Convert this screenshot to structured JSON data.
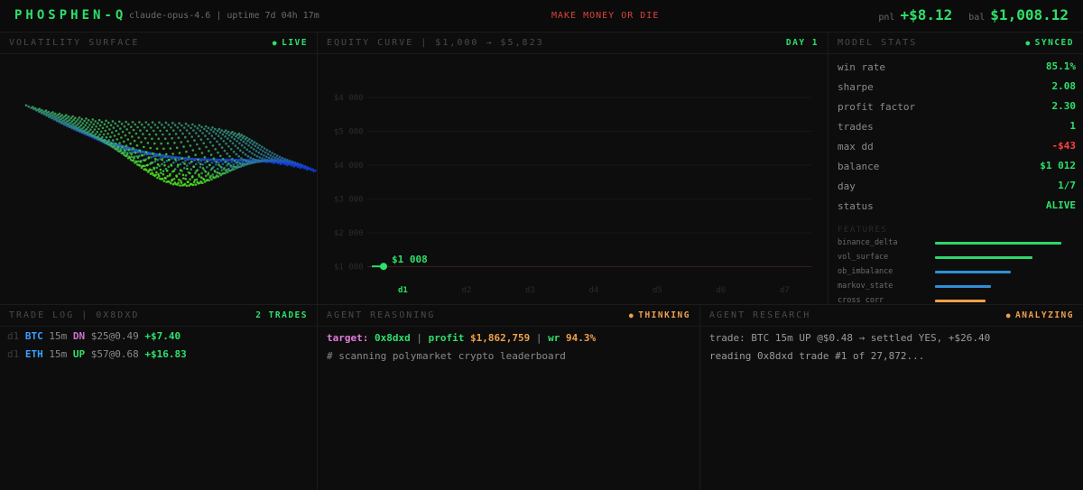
{
  "header": {
    "brand": "PHOSPHEN-Q",
    "subtitle": "claude-opus-4.6 | uptime 7d 04h 17m",
    "tagline": "MAKE MONEY OR DIE",
    "pnl_label": "pnl",
    "pnl_value": "+$8.12",
    "bal_label": "bal",
    "bal_value": "$1,008.12"
  },
  "colors": {
    "accent_green": "#2ee06a",
    "alert_red": "#d9433a",
    "orange": "#f0a04b",
    "blue": "#3aa0ff",
    "pink": "#d070c8"
  },
  "volatility": {
    "title": "VOLATILITY SURFACE",
    "badge": "LIVE"
  },
  "equity": {
    "title": "EQUITY CURVE | $1,000 → $5,823",
    "badge": "DAY 1",
    "y_ticks": [
      "$4 000",
      "$5 000",
      "$4 000",
      "$3 000",
      "$2 000",
      "$1 000"
    ],
    "x_ticks": [
      "d1",
      "d2",
      "d3",
      "d4",
      "d5",
      "d6",
      "d7"
    ],
    "annotation": "$1 008"
  },
  "chart_data": {
    "type": "line",
    "title": "EQUITY CURVE | $1,000 → $5,823",
    "x": [
      "d1"
    ],
    "series": [
      {
        "values": [
          1008
        ]
      }
    ],
    "categories": [
      "d1",
      "d2",
      "d3",
      "d4",
      "d5",
      "d6",
      "d7"
    ],
    "ylim": [
      0,
      6000
    ],
    "grid": true
  },
  "stats": {
    "title": "MODEL STATS",
    "badge": "SYNCED",
    "rows": [
      {
        "key": "win rate",
        "value": "85.1%"
      },
      {
        "key": "sharpe",
        "value": "2.08"
      },
      {
        "key": "profit factor",
        "value": "2.30"
      },
      {
        "key": "trades",
        "value": "1"
      },
      {
        "key": "max dd",
        "value": "-$43"
      },
      {
        "key": "balance",
        "value": "$1 012"
      },
      {
        "key": "day",
        "value": "1/7"
      },
      {
        "key": "status",
        "value": "ALIVE"
      }
    ],
    "features_header": "FEATURES",
    "features": [
      {
        "name": "binance_delta",
        "level": 0.93,
        "color": "#2ed66a"
      },
      {
        "name": "vol_surface",
        "level": 0.72,
        "color": "#2ed66a"
      },
      {
        "name": "ob_imbalance",
        "level": 0.56,
        "color": "#2f8fd6"
      },
      {
        "name": "markov_state",
        "level": 0.41,
        "color": "#2f8fd6"
      },
      {
        "name": "cross_corr",
        "level": 0.37,
        "color": "#f0a04b"
      }
    ]
  },
  "trade_log": {
    "title": "TRADE LOG | 0X8DXD",
    "badge": "2 TRADES",
    "rows": [
      {
        "day": "d1",
        "symbol": "BTC",
        "tf": "15m",
        "dir": "DN",
        "price": "$25@0.49",
        "pnl": "+$7.40"
      },
      {
        "day": "d1",
        "symbol": "ETH",
        "tf": "15m",
        "dir": "UP",
        "price": "$57@0.68",
        "pnl": "+$16.83"
      }
    ]
  },
  "reasoning": {
    "title": "AGENT REASONING",
    "badge": "THINKING",
    "target_label": "target:",
    "target_value": "0x8dxd",
    "profit_label": "profit",
    "profit_value": "$1,862,759",
    "wr_label": "wr",
    "wr_value": "94.3%",
    "sep": "|",
    "line2": "# scanning polymarket crypto leaderboard"
  },
  "research": {
    "title": "AGENT RESEARCH",
    "badge": "ANALYZING",
    "line1": "trade: BTC 15m UP @$0.48 → settled YES, +$26.40",
    "line2": "reading 0x8dxd trade #1 of 27,872..."
  }
}
